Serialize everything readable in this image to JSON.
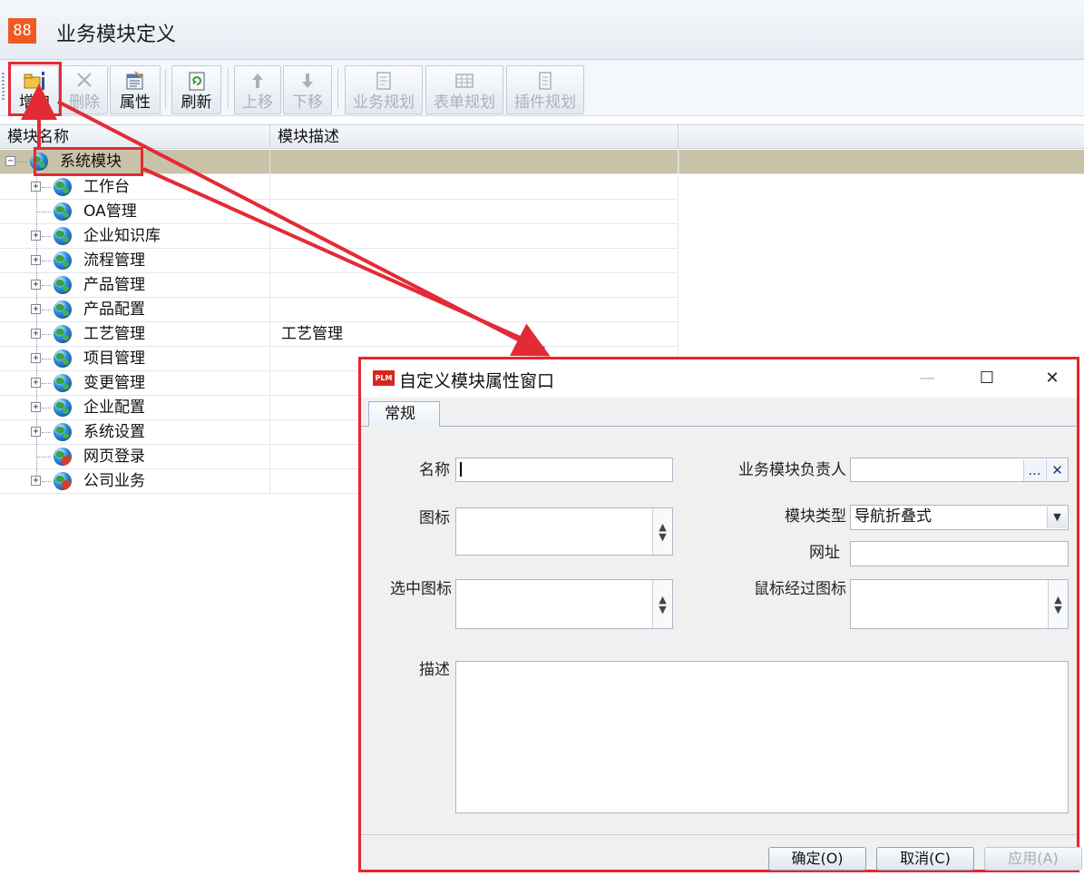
{
  "app": {
    "logo_text": "88",
    "title": "业务模块定义"
  },
  "toolbar": {
    "buttons": [
      {
        "label": "增加",
        "icon": "add-folder-icon",
        "enabled": true
      },
      {
        "label": "删除",
        "icon": "delete-x-icon",
        "enabled": false
      },
      {
        "label": "属性",
        "icon": "properties-icon",
        "enabled": true
      },
      {
        "label": "刷新",
        "icon": "refresh-icon",
        "enabled": true
      },
      {
        "label": "上移",
        "icon": "arrow-up-icon",
        "enabled": false
      },
      {
        "label": "下移",
        "icon": "arrow-down-icon",
        "enabled": false
      },
      {
        "label": "业务规划",
        "icon": "business-plan-icon",
        "enabled": false
      },
      {
        "label": "表单规划",
        "icon": "form-plan-icon",
        "enabled": false
      },
      {
        "label": "插件规划",
        "icon": "plugin-plan-icon",
        "enabled": false
      }
    ]
  },
  "grid": {
    "columns": [
      "模块名称",
      "模块描述"
    ],
    "root": {
      "label": "系统模块",
      "description": "",
      "expanded": true,
      "selected": true
    },
    "children": [
      {
        "label": "工作台",
        "description": "",
        "expandable": true,
        "icon": "globe-icon"
      },
      {
        "label": "OA管理",
        "description": "",
        "expandable": false,
        "icon": "globe-icon"
      },
      {
        "label": "企业知识库",
        "description": "",
        "expandable": true,
        "icon": "globe-icon"
      },
      {
        "label": "流程管理",
        "description": "",
        "expandable": true,
        "icon": "globe-icon"
      },
      {
        "label": "产品管理",
        "description": "",
        "expandable": true,
        "icon": "globe-icon"
      },
      {
        "label": "产品配置",
        "description": "",
        "expandable": true,
        "icon": "globe-icon"
      },
      {
        "label": "工艺管理",
        "description": "工艺管理",
        "expandable": true,
        "icon": "globe-icon"
      },
      {
        "label": "项目管理",
        "description": "",
        "expandable": true,
        "icon": "globe-icon"
      },
      {
        "label": "变更管理",
        "description": "",
        "expandable": true,
        "icon": "globe-icon"
      },
      {
        "label": "企业配置",
        "description": "",
        "expandable": true,
        "icon": "globe-icon"
      },
      {
        "label": "系统设置",
        "description": "",
        "expandable": true,
        "icon": "globe-icon"
      },
      {
        "label": "网页登录",
        "description": "",
        "expandable": false,
        "icon": "globe-person-icon"
      },
      {
        "label": "公司业务",
        "description": "",
        "expandable": true,
        "icon": "globe-person-icon"
      }
    ]
  },
  "dialog": {
    "icon_text": "PLM",
    "title": "自定义模块属性窗口",
    "tabs": [
      "常规"
    ],
    "fields": {
      "name": {
        "label": "名称",
        "value": ""
      },
      "owner": {
        "label": "业务模块负责人",
        "value": "",
        "browse": "...",
        "clear": "✕"
      },
      "icon": {
        "label": "图标",
        "value": ""
      },
      "module_type": {
        "label": "模块类型",
        "value": "导航折叠式"
      },
      "url": {
        "label": "网址",
        "value": ""
      },
      "selected_icon": {
        "label": "选中图标",
        "value": ""
      },
      "hover_icon": {
        "label": "鼠标经过图标",
        "value": ""
      },
      "description": {
        "label": "描述",
        "value": ""
      }
    },
    "buttons": {
      "ok": "确定(O)",
      "cancel": "取消(C)",
      "apply": "应用(A)"
    },
    "window_controls": {
      "minimize": "—",
      "maximize": "☐",
      "close": "✕"
    }
  },
  "colors": {
    "annotation_red": "#e32b35",
    "selected_row": "#c8c3a8",
    "logo_orange": "#f05a22"
  }
}
